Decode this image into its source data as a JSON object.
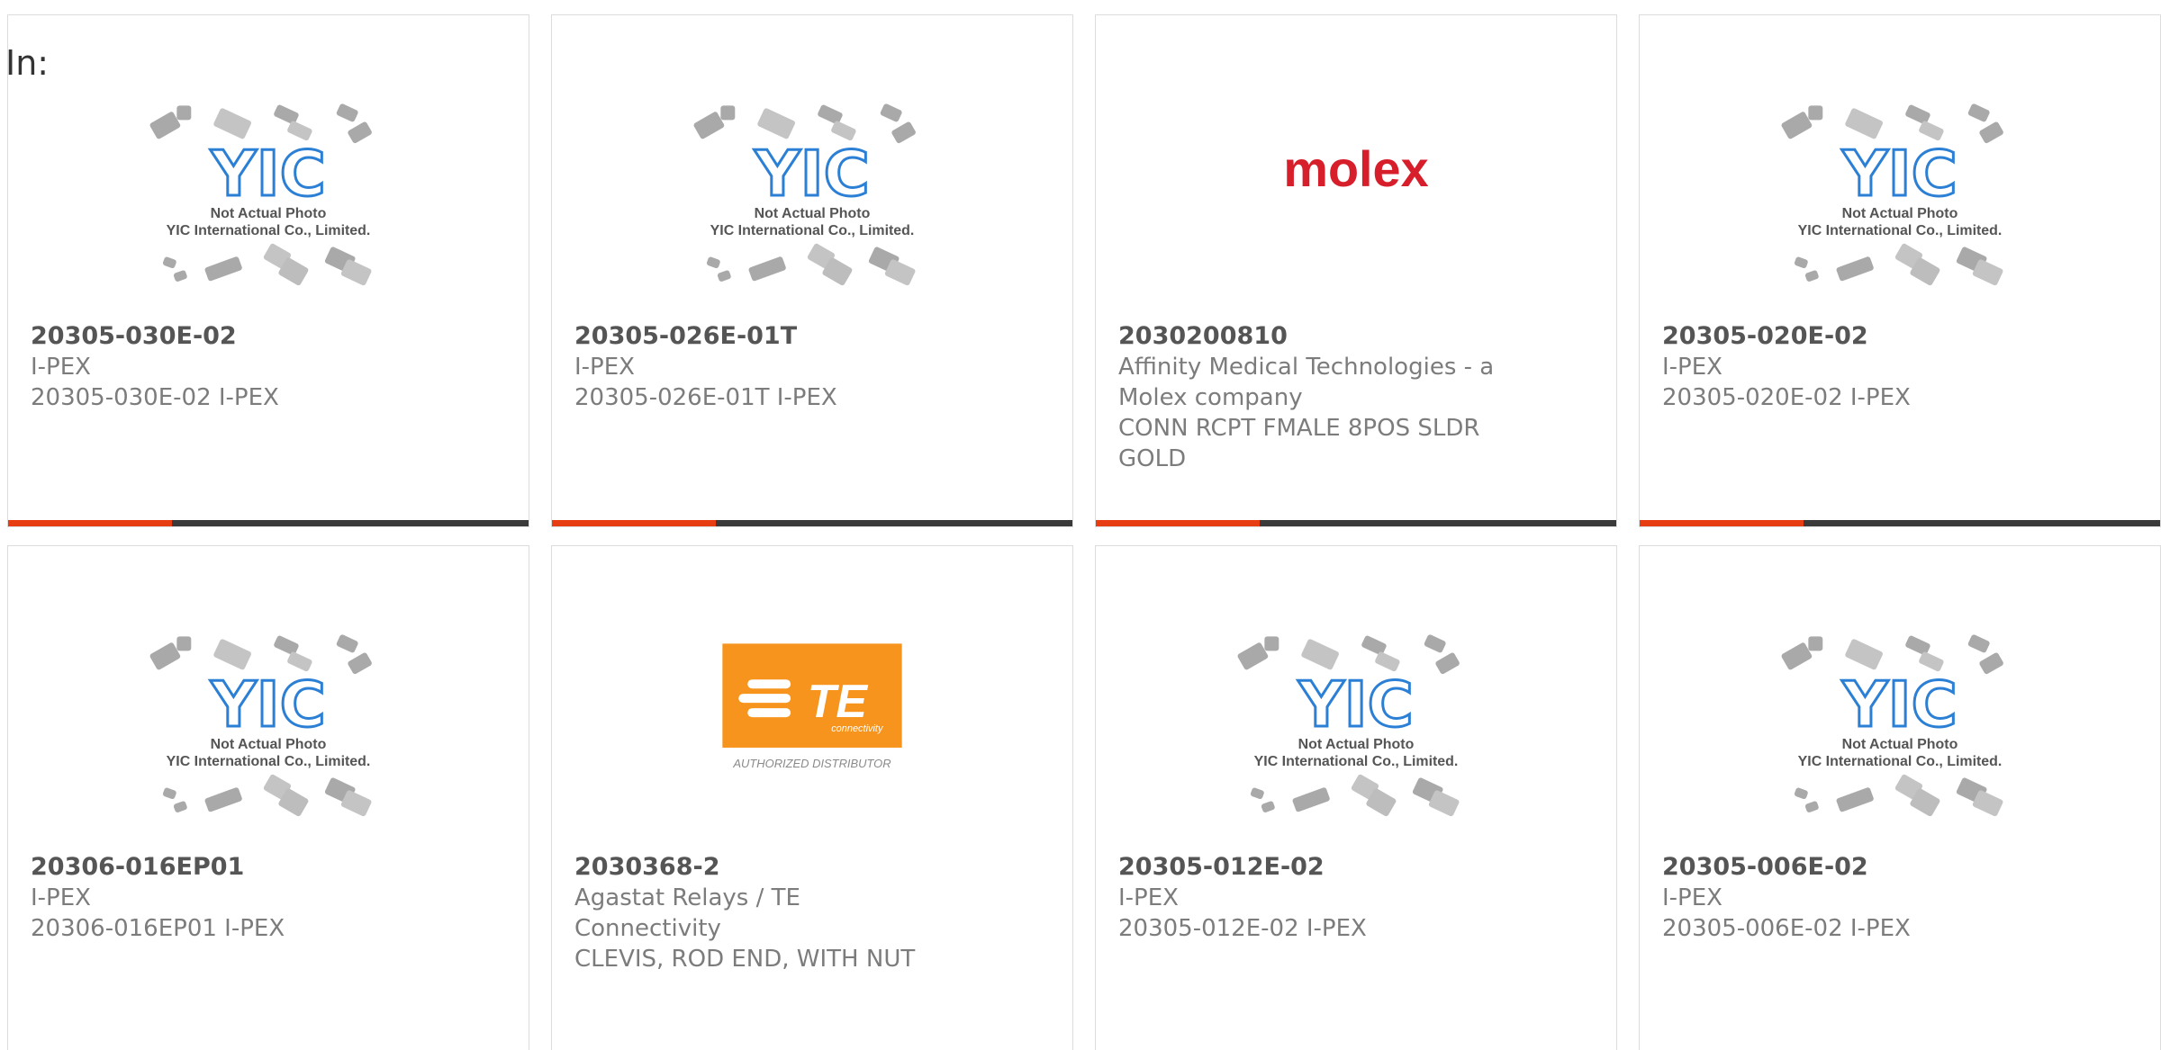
{
  "header": {
    "in_label": "In:"
  },
  "colors": {
    "accent": "#e63e12",
    "bar": "#3a3a3a",
    "yic_blue": "#2b7fd4",
    "te_orange": "#f7941d",
    "molex_red": "#d71e2b"
  },
  "placeholder_image": {
    "line1": "Not Actual Photo",
    "line2": "YIC International Co., Limited."
  },
  "molex_logo": {
    "text": "molex"
  },
  "te_logo": {
    "text": "TE",
    "sub": "connectivity",
    "caption": "AUTHORIZED DISTRIBUTOR"
  },
  "cards": [
    {
      "part": "20305-030E-02",
      "lines": [
        "I-PEX",
        "20305-030E-02 I-PEX"
      ],
      "image": "yic-placeholder"
    },
    {
      "part": "20305-026E-01T",
      "lines": [
        "I-PEX",
        "20305-026E-01T I-PEX"
      ],
      "image": "yic-placeholder"
    },
    {
      "part": "2030200810",
      "lines": [
        "Affinity Medical Technologies - a",
        "Molex company",
        "CONN RCPT FMALE 8POS SLDR",
        "GOLD"
      ],
      "image": "molex-logo"
    },
    {
      "part": "20305-020E-02",
      "lines": [
        "I-PEX",
        "20305-020E-02 I-PEX"
      ],
      "image": "yic-placeholder"
    },
    {
      "part": "20306-016EP01",
      "lines": [
        "I-PEX",
        "20306-016EP01 I-PEX"
      ],
      "image": "yic-placeholder"
    },
    {
      "part": "2030368-2",
      "lines": [
        "Agastat Relays / TE Connectivity",
        "CLEVIS, ROD END, WITH NUT"
      ],
      "image": "te-logo"
    },
    {
      "part": "20305-012E-02",
      "lines": [
        "I-PEX",
        "20305-012E-02 I-PEX"
      ],
      "image": "yic-placeholder"
    },
    {
      "part": "20305-006E-02",
      "lines": [
        "I-PEX",
        "20305-006E-02 I-PEX"
      ],
      "image": "yic-placeholder"
    }
  ]
}
